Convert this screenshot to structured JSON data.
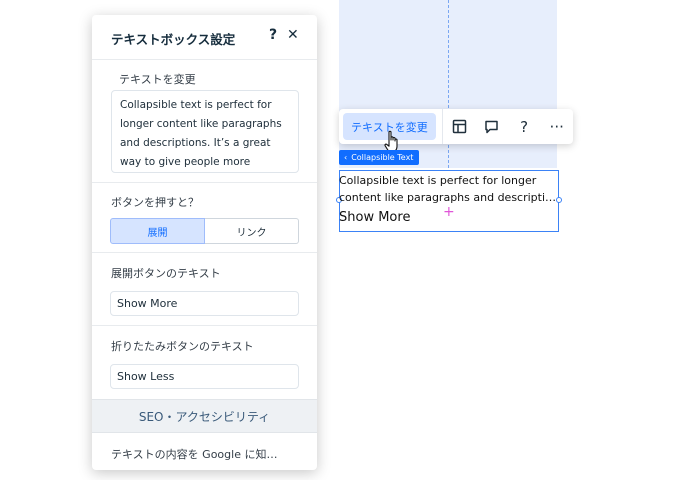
{
  "canvas": {
    "toolbar": {
      "primary_label": "テキストを変更",
      "icons": [
        "layout-icon",
        "comment-icon",
        "help-icon",
        "more-icon"
      ],
      "help_glyph": "?",
      "more_glyph": "···"
    },
    "component_tag": "Collapsible Text",
    "component_tag_chevron": "‹",
    "component_text_line1": "Collapsible text is perfect for longer",
    "component_text_line2": "content like paragraphs and descriptions...",
    "component_show_more": "Show More",
    "accent_color": "#116dff"
  },
  "panel": {
    "title": "テキストボックス設定",
    "help_glyph": "?",
    "close_glyph": "✕",
    "change_text_label": "テキストを変更",
    "change_text_value": "Collapsible text is perfect for longer content like paragraphs and descriptions. It’s a great way to give people more information",
    "button_action_label": "ボタンを押すと？",
    "button_action_options": [
      "展開",
      "リンク"
    ],
    "button_action_selected": "展開",
    "expand_label": "展開ボタンのテキスト",
    "expand_value": "Show More",
    "collapse_label": "折りたたみボタンのテキスト",
    "collapse_value": "Show Less",
    "seo_section": "SEO・アクセシビリティ",
    "seo_item": "テキストの内容を Google に知…"
  }
}
